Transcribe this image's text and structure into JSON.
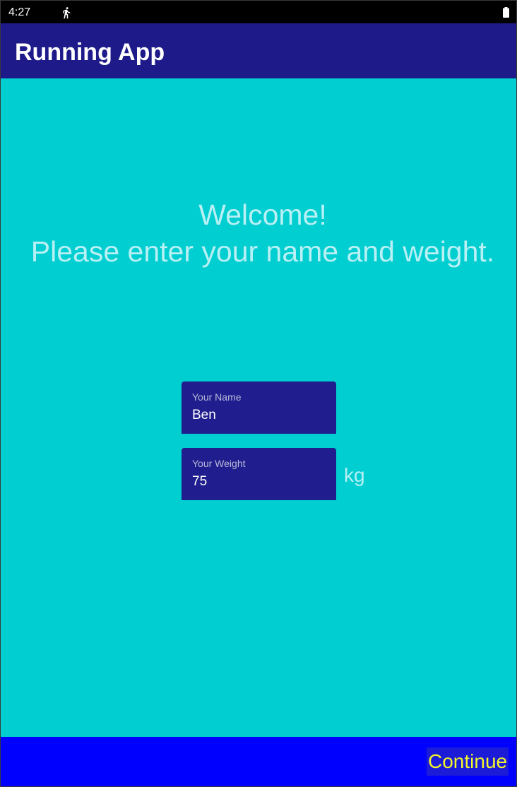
{
  "status_bar": {
    "time": "4:27",
    "icons": [
      "running-icon",
      "battery-icon"
    ]
  },
  "app_bar": {
    "title": "Running App",
    "color": "#1e1a8a"
  },
  "main": {
    "background_color": "#00ced1",
    "welcome_line1": "Welcome!",
    "welcome_line2": "Please enter your name and weight.",
    "name_field": {
      "label": "Your Name",
      "value": "Ben"
    },
    "weight_field": {
      "label": "Your Weight",
      "value": "75",
      "unit": "kg"
    }
  },
  "bottom_bar": {
    "continue_label": "Continue",
    "background_color": "#0000ff",
    "label_color": "#f5f52a"
  }
}
